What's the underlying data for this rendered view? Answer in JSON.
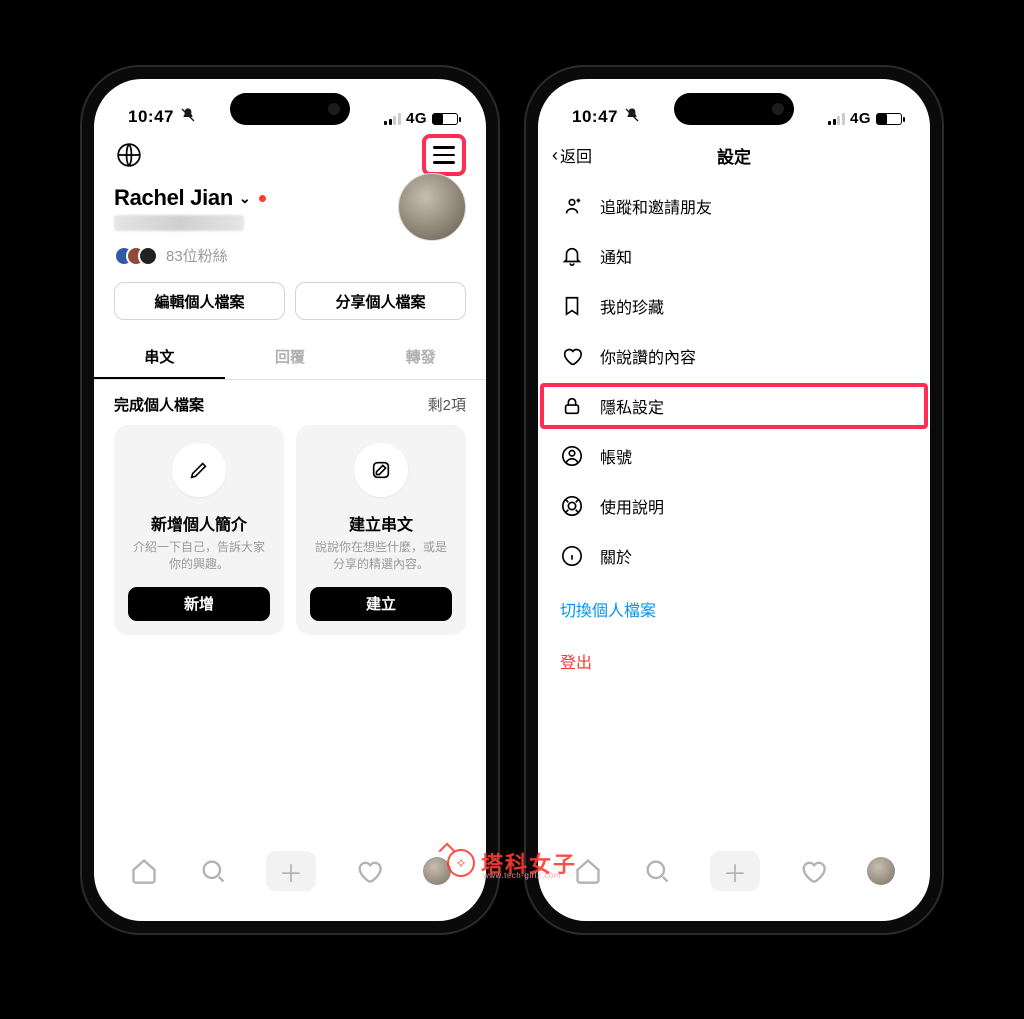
{
  "status": {
    "time": "10:47",
    "network_label": "4G"
  },
  "left": {
    "display_name": "Rachel Jian",
    "followers_text": "83位粉絲",
    "buttons": {
      "edit_profile": "編輯個人檔案",
      "share_profile": "分享個人檔案"
    },
    "tabs": {
      "threads": "串文",
      "replies": "回覆",
      "reposts": "轉發"
    },
    "onboarding": {
      "title": "完成個人檔案",
      "remaining": "剩2項",
      "cards": [
        {
          "title": "新增個人簡介",
          "desc": "介紹一下自己，告訴大家你的興趣。",
          "btn": "新增"
        },
        {
          "title": "建立串文",
          "desc": "說說你在想些什麼，或是分享的精選內容。",
          "btn": "建立"
        }
      ]
    }
  },
  "right": {
    "back_label": "返回",
    "title": "設定",
    "items": {
      "follow_invite": "追蹤和邀請朋友",
      "notifications": "通知",
      "saved": "我的珍藏",
      "liked": "你說讚的內容",
      "privacy": "隱私設定",
      "account": "帳號",
      "help": "使用說明",
      "about": "關於"
    },
    "switch_profile": "切換個人檔案",
    "logout": "登出"
  },
  "watermark": {
    "text": "塔科女子",
    "sub": "www.tech-girlz.com"
  }
}
